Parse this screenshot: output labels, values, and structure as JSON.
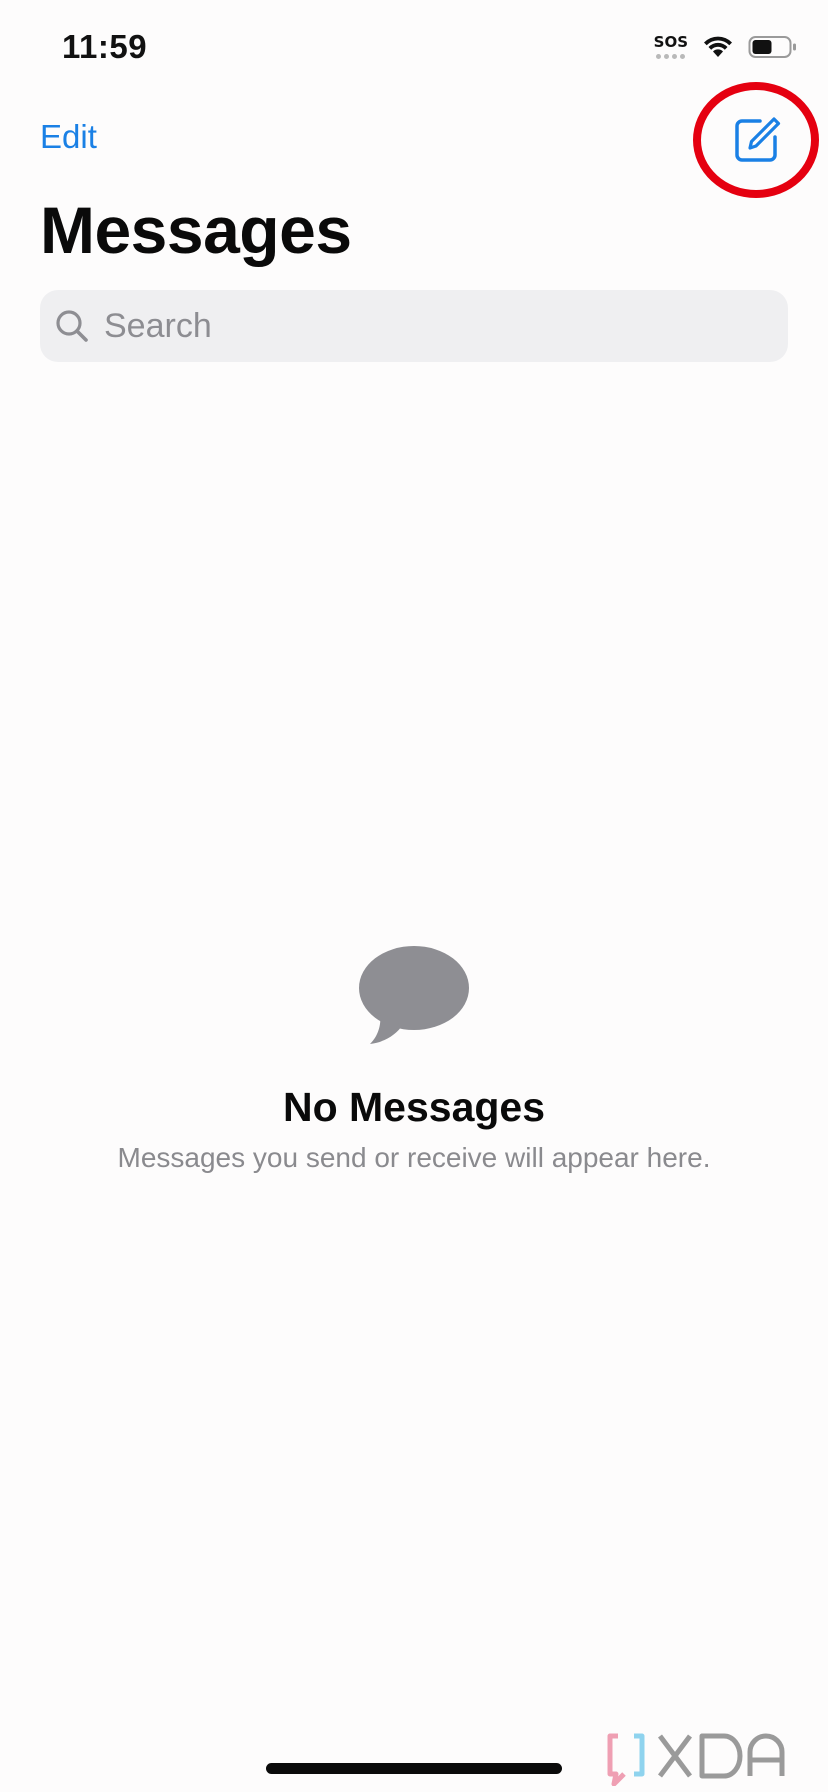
{
  "status_bar": {
    "time": "11:59",
    "sos_label": "SOS",
    "icons": [
      "cellular-sos-icon",
      "wifi-icon",
      "battery-icon"
    ]
  },
  "nav": {
    "edit_label": "Edit",
    "compose_icon": "compose-icon",
    "highlight_color": "#e50010"
  },
  "header": {
    "title": "Messages"
  },
  "search": {
    "placeholder": "Search",
    "icon": "search-icon"
  },
  "empty_state": {
    "icon": "speech-bubble-icon",
    "title": "No Messages",
    "subtitle": "Messages you send or receive will appear here."
  },
  "watermark": {
    "text": "XDA"
  },
  "colors": {
    "accent": "#1a80e5",
    "secondary_text": "#8a8a8e",
    "icon_gray": "#8e8e93"
  }
}
